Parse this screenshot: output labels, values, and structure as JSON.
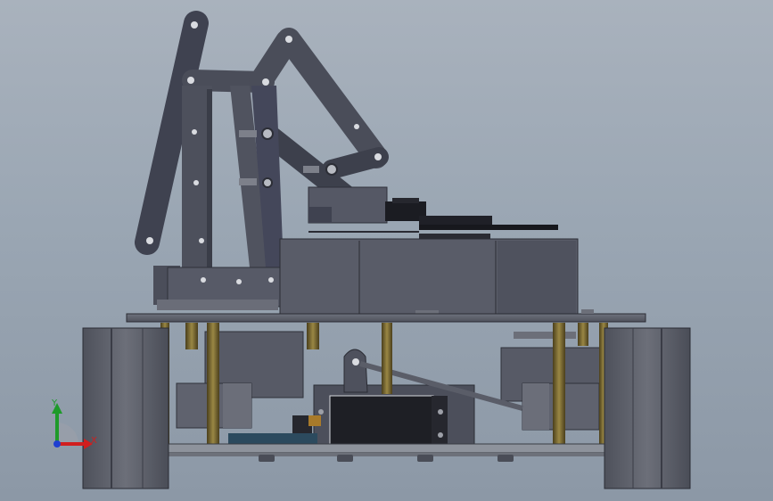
{
  "viewport": {
    "background_top": "#a9b2bd",
    "background_bottom": "#8c98a6"
  },
  "model": {
    "body_color": "#5b5e69",
    "dark_color": "#3f4250",
    "wheel_color": "#62656f",
    "standoff_color": "#7a6a34"
  },
  "triad": {
    "x_label": "X",
    "y_label": "Y",
    "x_color": "#d11e1e",
    "y_color": "#1e9a2a",
    "z_color": "#1f3fd1"
  }
}
